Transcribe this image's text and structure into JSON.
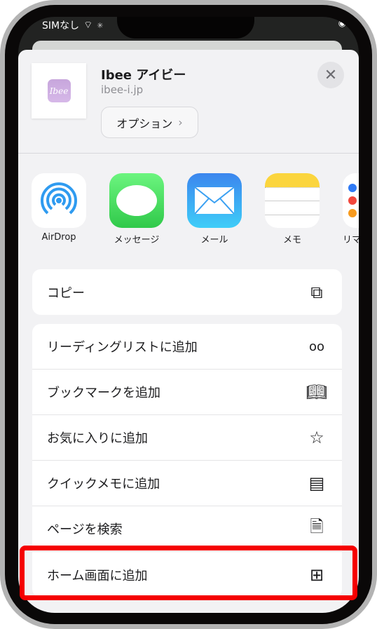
{
  "status_bar": {
    "carrier": "SIMなし"
  },
  "share_sheet": {
    "title": "Ibee アイビー",
    "domain": "ibee-i.jp",
    "logo_text": "Ibee",
    "options_label": "オプション",
    "apps": [
      {
        "label": "AirDrop",
        "icon": "airdrop-icon"
      },
      {
        "label": "メッセージ",
        "icon": "messages-icon"
      },
      {
        "label": "メール",
        "icon": "mail-icon"
      },
      {
        "label": "メモ",
        "icon": "notes-icon"
      },
      {
        "label": "リマ",
        "icon": "reminders-icon"
      }
    ],
    "copy": {
      "label": "コピー",
      "icon": "copy-icon"
    },
    "actions": [
      {
        "label": "リーディングリストに追加",
        "icon": "glasses-icon"
      },
      {
        "label": "ブックマークを追加",
        "icon": "book-icon"
      },
      {
        "label": "お気に入りに追加",
        "icon": "star-icon"
      },
      {
        "label": "クイックメモに追加",
        "icon": "quick-note-icon"
      },
      {
        "label": "ページを検索",
        "icon": "find-in-page-icon"
      },
      {
        "label": "ホーム画面に追加",
        "icon": "add-square-icon"
      }
    ]
  },
  "highlight_color": "#f50000"
}
